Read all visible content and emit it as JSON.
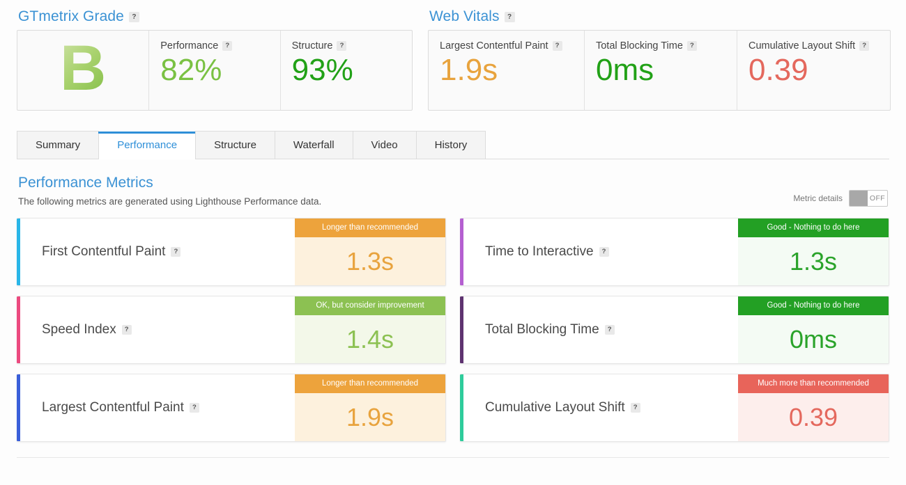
{
  "grade_panel": {
    "title": "GTmetrix Grade",
    "help": "?",
    "grade": "B",
    "metrics": [
      {
        "label": "Performance",
        "value": "82%",
        "color": "#7ac143"
      },
      {
        "label": "Structure",
        "value": "93%",
        "color": "#22a117"
      }
    ]
  },
  "vitals_panel": {
    "title": "Web Vitals",
    "help": "?",
    "metrics": [
      {
        "label": "Largest Contentful Paint",
        "value": "1.9s",
        "color": "#e8a33d"
      },
      {
        "label": "Total Blocking Time",
        "value": "0ms",
        "color": "#22a117"
      },
      {
        "label": "Cumulative Layout Shift",
        "value": "0.39",
        "color": "#e4685d"
      }
    ]
  },
  "tabs": [
    {
      "label": "Summary",
      "active": false
    },
    {
      "label": "Performance",
      "active": true
    },
    {
      "label": "Structure",
      "active": false
    },
    {
      "label": "Waterfall",
      "active": false
    },
    {
      "label": "Video",
      "active": false
    },
    {
      "label": "History",
      "active": false
    }
  ],
  "section": {
    "title": "Performance Metrics",
    "subtitle": "The following metrics are generated using Lighthouse Performance data.",
    "toggle_label": "Metric details",
    "toggle_state": "OFF"
  },
  "metrics": [
    {
      "name": "First Contentful Paint",
      "value": "1.3s",
      "banner": "Longer than recommended",
      "accent": "#29b6e8",
      "status": "warn"
    },
    {
      "name": "Time to Interactive",
      "value": "1.3s",
      "banner": "Good - Nothing to do here",
      "accent": "#b45fd0",
      "status": "good"
    },
    {
      "name": "Speed Index",
      "value": "1.4s",
      "banner": "OK, but consider improvement",
      "accent": "#ec4a7f",
      "status": "ok"
    },
    {
      "name": "Total Blocking Time",
      "value": "0ms",
      "banner": "Good - Nothing to do here",
      "accent": "#5e3370",
      "status": "good"
    },
    {
      "name": "Largest Contentful Paint",
      "value": "1.9s",
      "banner": "Longer than recommended",
      "accent": "#3a5fd9",
      "status": "warn"
    },
    {
      "name": "Cumulative Layout Shift",
      "value": "0.39",
      "banner": "Much more than recommended",
      "accent": "#2ecc9b",
      "status": "bad"
    }
  ]
}
